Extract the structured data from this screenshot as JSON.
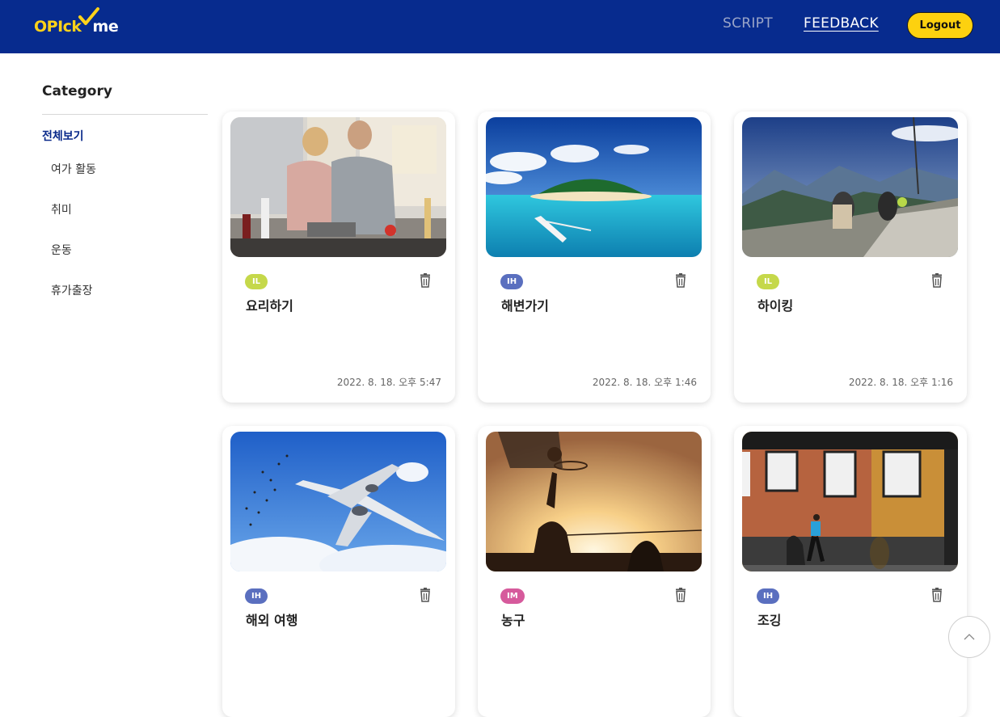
{
  "header": {
    "logo_parts": [
      "OPIck",
      "me"
    ],
    "nav": {
      "script": "SCRIPT",
      "feedback": "FEEDBACK"
    },
    "logout": "Logout",
    "colors": {
      "bar": "#072b8e",
      "accent": "#fdd10f"
    }
  },
  "sidebar": {
    "title": "Category",
    "all": "전체보기",
    "items": [
      "여가 활동",
      "취미",
      "운동",
      "휴가출장"
    ]
  },
  "cards": [
    {
      "badge": "IL",
      "badge_color": "#c5d84a",
      "title": "요리하기",
      "date": "2022. 8. 18. 오후 5:47",
      "image": "cooking-photo"
    },
    {
      "badge": "IH",
      "badge_color": "#5a6fbf",
      "title": "해변가기",
      "date": "2022. 8. 18. 오후 1:46",
      "image": "beach-island-photo"
    },
    {
      "badge": "IL",
      "badge_color": "#c5d84a",
      "title": "하이킹",
      "date": "2022. 8. 18. 오후 1:16",
      "image": "hiking-mountains-photo"
    },
    {
      "badge": "IH",
      "badge_color": "#5a6fbf",
      "title": "해외 여행",
      "date": "",
      "image": "airplane-sky-photo"
    },
    {
      "badge": "IM",
      "badge_color": "#d65a9c",
      "title": "농구",
      "date": "",
      "image": "basketball-sunset-photo"
    },
    {
      "badge": "IH",
      "badge_color": "#5a6fbf",
      "title": "조깅",
      "date": "",
      "image": "jogging-street-photo"
    }
  ],
  "icons": {
    "delete": "trash-icon",
    "scroll_top": "chevron-up-icon"
  }
}
